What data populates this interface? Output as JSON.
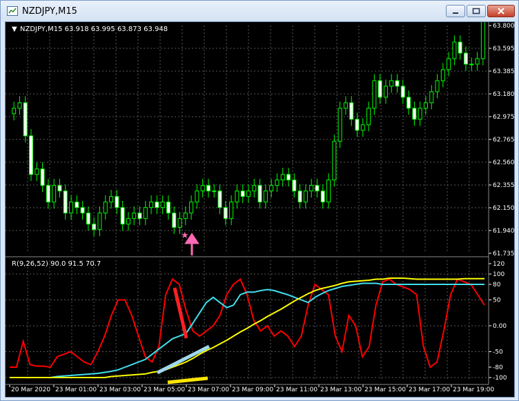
{
  "window": {
    "title": "NZDJPY,M15"
  },
  "colors": {
    "background": "#000000",
    "candle_up_fill": "#000000",
    "candle_down_fill": "#ffffff",
    "candle_line": "#00ff00",
    "grid": "#5a5a5a",
    "text": "#ffffff",
    "rsi_line": "#ff0000",
    "ma_fast": "#40e0f0",
    "ma_slow": "#ffff00",
    "arrow": "#ff69b4"
  },
  "price_panel": {
    "header": "NZDJPY,M15  63.918 63.995 63.873 63.948",
    "y_labels": [
      "63.800",
      "63.595",
      "63.385",
      "63.180",
      "62.975",
      "62.765",
      "62.560",
      "62.355",
      "62.150",
      "61.940",
      "61.735"
    ]
  },
  "indicator_panel": {
    "header": "R(9,26,52) 90.0 91.5 70.7",
    "y_labels": [
      "120",
      "100",
      "80",
      "50",
      "0.00",
      "-50",
      "-80",
      "-100"
    ]
  },
  "time_labels": [
    "20 Mar 2020",
    "23 Mar 01:00",
    "23 Mar 03:00",
    "23 Mar 05:00",
    "23 Mar 07:00",
    "23 Mar 09:00",
    "23 Mar 11:00",
    "23 Mar 13:00",
    "23 Mar 15:00",
    "23 Mar 17:00",
    "23 Mar 19:00"
  ],
  "chart_data": [
    {
      "type": "candlestick",
      "title": "NZDJPY,M15",
      "ylim": [
        61.735,
        63.8
      ],
      "open": [
        63.0,
        63.05,
        63.1,
        62.8,
        62.45,
        62.5,
        62.35,
        62.2,
        62.35,
        62.3,
        62.1,
        62.2,
        62.15,
        62.1,
        62.0,
        61.95,
        62.1,
        62.2,
        62.25,
        62.15,
        62.0,
        62.05,
        62.1,
        62.05,
        62.15,
        62.2,
        62.15,
        62.2,
        62.1,
        61.97,
        62.05,
        62.1,
        62.2,
        62.3,
        62.35,
        62.3,
        62.3,
        62.15,
        62.05,
        62.2,
        62.3,
        62.25,
        62.3,
        62.35,
        62.2,
        62.3,
        62.35,
        62.4,
        62.45,
        62.4,
        62.3,
        62.2,
        62.3,
        62.35,
        62.3,
        62.2,
        62.4,
        62.75,
        63.05,
        63.1,
        62.95,
        62.85,
        62.9,
        63.05,
        63.3,
        63.15,
        63.25,
        63.3,
        63.25,
        63.15,
        63.05,
        62.95,
        63.05,
        63.1,
        63.2,
        63.3,
        63.4,
        63.5,
        63.65,
        63.55,
        63.45,
        63.45,
        63.5
      ]
    },
    {
      "type": "line",
      "title": "R(9,26,52) 90.0 91.5 70.7",
      "ylim": [
        -100,
        120
      ],
      "series": [
        {
          "color": "#ff0000",
          "values": [
            -80,
            -80,
            -30,
            -75,
            -78,
            -78,
            -80,
            -60,
            -55,
            -50,
            -60,
            -70,
            -75,
            -50,
            -20,
            20,
            50,
            50,
            20,
            -20,
            -60,
            -70,
            -40,
            60,
            90,
            80,
            30,
            -10,
            -20,
            -10,
            0,
            20,
            60,
            80,
            90,
            60,
            10,
            -10,
            0,
            -20,
            -10,
            -20,
            -40,
            -20,
            40,
            80,
            70,
            60,
            -20,
            -50,
            20,
            0,
            -60,
            -40,
            40,
            85,
            90,
            80,
            75,
            70,
            60,
            -40,
            -80,
            -70,
            -10,
            60,
            90,
            85,
            80,
            60,
            40
          ]
        },
        {
          "color": "#40e0f0",
          "values": [
            -100,
            -100,
            -100,
            -100,
            -100,
            -100,
            -100,
            -98,
            -97,
            -96,
            -95,
            -94,
            -93,
            -92,
            -90,
            -88,
            -85,
            -80,
            -75,
            -70,
            -65,
            -55,
            -45,
            -35,
            -25,
            -20,
            -15,
            5,
            25,
            45,
            55,
            45,
            35,
            40,
            60,
            65,
            65,
            68,
            70,
            68,
            64,
            60,
            55,
            50,
            45,
            55,
            62,
            68,
            72,
            76,
            78,
            80,
            82,
            82,
            82,
            80,
            80,
            80,
            80,
            80,
            80,
            80,
            80,
            80,
            80,
            80,
            80,
            80,
            80,
            80,
            80
          ]
        },
        {
          "color": "#ffff00",
          "values": [
            -100,
            -100,
            -100,
            -100,
            -100,
            -100,
            -100,
            -100,
            -100,
            -100,
            -100,
            -100,
            -100,
            -100,
            -100,
            -98,
            -97,
            -96,
            -95,
            -94,
            -93,
            -90,
            -88,
            -85,
            -80,
            -75,
            -70,
            -63,
            -55,
            -48,
            -42,
            -35,
            -28,
            -20,
            -12,
            -5,
            3,
            10,
            18,
            25,
            32,
            40,
            48,
            55,
            62,
            68,
            72,
            75,
            78,
            82,
            85,
            86,
            87,
            88,
            90,
            90,
            92,
            92,
            92,
            91,
            90,
            90,
            90,
            90,
            90,
            90,
            90,
            91,
            91,
            91,
            91
          ]
        }
      ]
    }
  ]
}
